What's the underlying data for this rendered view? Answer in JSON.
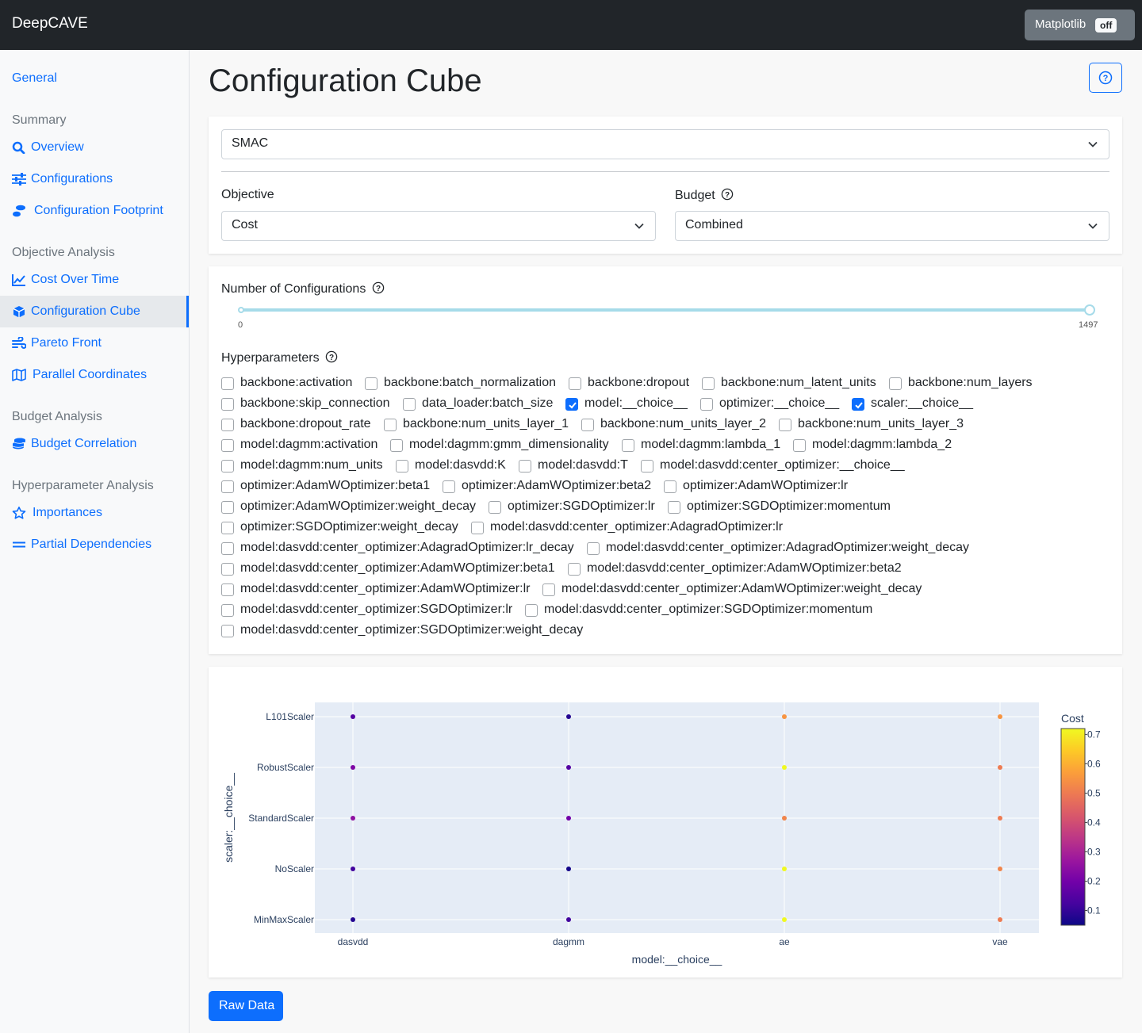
{
  "header": {
    "brand": "DeepCAVE",
    "matplotlib_label": "Matplotlib",
    "matplotlib_state": "off"
  },
  "sidebar": {
    "general": "General",
    "sections": [
      {
        "heading": "Summary",
        "items": [
          {
            "label": "Overview",
            "icon": "search-icon"
          },
          {
            "label": "Configurations",
            "icon": "sliders-icon"
          },
          {
            "label": "Configuration Footprint",
            "icon": "footprint-icon"
          }
        ]
      },
      {
        "heading": "Objective Analysis",
        "items": [
          {
            "label": "Cost Over Time",
            "icon": "line-chart-icon"
          },
          {
            "label": "Configuration Cube",
            "icon": "cube-icon",
            "active": true
          },
          {
            "label": "Pareto Front",
            "icon": "wind-icon"
          },
          {
            "label": "Parallel Coordinates",
            "icon": "map-icon"
          }
        ]
      },
      {
        "heading": "Budget Analysis",
        "items": [
          {
            "label": "Budget Correlation",
            "icon": "coins-icon"
          }
        ]
      },
      {
        "heading": "Hyperparameter Analysis",
        "items": [
          {
            "label": "Importances",
            "icon": "star-icon"
          },
          {
            "label": "Partial Dependencies",
            "icon": "equals-icon"
          }
        ]
      }
    ]
  },
  "main": {
    "title": "Configuration Cube",
    "run_select": "SMAC",
    "objective_label": "Objective",
    "objective_value": "Cost",
    "budget_label": "Budget",
    "budget_value": "Combined",
    "n_configs_label": "Number of Configurations",
    "slider": {
      "min": "0",
      "max": "1497",
      "value_fraction": 1.0
    },
    "hyperparameters_label": "Hyperparameters",
    "hyperparameters": [
      [
        {
          "label": "backbone:activation",
          "checked": false
        },
        {
          "label": "backbone:batch_normalization",
          "checked": false
        },
        {
          "label": "backbone:dropout",
          "checked": false
        },
        {
          "label": "backbone:num_latent_units",
          "checked": false
        },
        {
          "label": "backbone:num_layers",
          "checked": false
        }
      ],
      [
        {
          "label": "backbone:skip_connection",
          "checked": false
        },
        {
          "label": "data_loader:batch_size",
          "checked": false
        },
        {
          "label": "model:__choice__",
          "checked": true
        },
        {
          "label": "optimizer:__choice__",
          "checked": false
        },
        {
          "label": "scaler:__choice__",
          "checked": true
        }
      ],
      [
        {
          "label": "backbone:dropout_rate",
          "checked": false
        },
        {
          "label": "backbone:num_units_layer_1",
          "checked": false
        },
        {
          "label": "backbone:num_units_layer_2",
          "checked": false
        },
        {
          "label": "backbone:num_units_layer_3",
          "checked": false
        }
      ],
      [
        {
          "label": "model:dagmm:activation",
          "checked": false
        },
        {
          "label": "model:dagmm:gmm_dimensionality",
          "checked": false
        },
        {
          "label": "model:dagmm:lambda_1",
          "checked": false
        },
        {
          "label": "model:dagmm:lambda_2",
          "checked": false
        }
      ],
      [
        {
          "label": "model:dagmm:num_units",
          "checked": false
        },
        {
          "label": "model:dasvdd:K",
          "checked": false
        },
        {
          "label": "model:dasvdd:T",
          "checked": false
        },
        {
          "label": "model:dasvdd:center_optimizer:__choice__",
          "checked": false
        }
      ],
      [
        {
          "label": "optimizer:AdamWOptimizer:beta1",
          "checked": false
        },
        {
          "label": "optimizer:AdamWOptimizer:beta2",
          "checked": false
        },
        {
          "label": "optimizer:AdamWOptimizer:lr",
          "checked": false
        }
      ],
      [
        {
          "label": "optimizer:AdamWOptimizer:weight_decay",
          "checked": false
        },
        {
          "label": "optimizer:SGDOptimizer:lr",
          "checked": false
        },
        {
          "label": "optimizer:SGDOptimizer:momentum",
          "checked": false
        }
      ],
      [
        {
          "label": "optimizer:SGDOptimizer:weight_decay",
          "checked": false
        },
        {
          "label": "model:dasvdd:center_optimizer:AdagradOptimizer:lr",
          "checked": false
        }
      ],
      [
        {
          "label": "model:dasvdd:center_optimizer:AdagradOptimizer:lr_decay",
          "checked": false
        },
        {
          "label": "model:dasvdd:center_optimizer:AdagradOptimizer:weight_decay",
          "checked": false
        }
      ],
      [
        {
          "label": "model:dasvdd:center_optimizer:AdamWOptimizer:beta1",
          "checked": false
        },
        {
          "label": "model:dasvdd:center_optimizer:AdamWOptimizer:beta2",
          "checked": false
        }
      ],
      [
        {
          "label": "model:dasvdd:center_optimizer:AdamWOptimizer:lr",
          "checked": false
        },
        {
          "label": "model:dasvdd:center_optimizer:AdamWOptimizer:weight_decay",
          "checked": false
        }
      ],
      [
        {
          "label": "model:dasvdd:center_optimizer:SGDOptimizer:lr",
          "checked": false
        },
        {
          "label": "model:dasvdd:center_optimizer:SGDOptimizer:momentum",
          "checked": false
        }
      ],
      [
        {
          "label": "model:dasvdd:center_optimizer:SGDOptimizer:weight_decay",
          "checked": false
        }
      ]
    ],
    "raw_data_button": "Raw Data"
  },
  "chart_data": {
    "type": "scatter",
    "x_categories": [
      "dasvdd",
      "dagmm",
      "ae",
      "vae"
    ],
    "y_categories": [
      "MinMaxScaler",
      "NoScaler",
      "StandardScaler",
      "RobustScaler",
      "L101Scaler"
    ],
    "xlabel": "model:__choice__",
    "ylabel": "scaler:__choice__",
    "colorbar_title": "Cost",
    "colorbar_ticks": [
      "0.1",
      "0.2",
      "0.3",
      "0.4",
      "0.5",
      "0.6",
      "0.7"
    ],
    "colorscale": "plasma",
    "crange": [
      0.05,
      0.72
    ],
    "points": [
      {
        "x": "dasvdd",
        "y": "L101Scaler",
        "cost": 0.15
      },
      {
        "x": "dagmm",
        "y": "L101Scaler",
        "cost": 0.08
      },
      {
        "x": "ae",
        "y": "L101Scaler",
        "cost": 0.55
      },
      {
        "x": "vae",
        "y": "L101Scaler",
        "cost": 0.55
      },
      {
        "x": "dasvdd",
        "y": "RobustScaler",
        "cost": 0.22
      },
      {
        "x": "dagmm",
        "y": "RobustScaler",
        "cost": 0.15
      },
      {
        "x": "ae",
        "y": "RobustScaler",
        "cost": 0.72
      },
      {
        "x": "vae",
        "y": "RobustScaler",
        "cost": 0.5
      },
      {
        "x": "dasvdd",
        "y": "StandardScaler",
        "cost": 0.25
      },
      {
        "x": "dagmm",
        "y": "StandardScaler",
        "cost": 0.2
      },
      {
        "x": "ae",
        "y": "StandardScaler",
        "cost": 0.52
      },
      {
        "x": "vae",
        "y": "StandardScaler",
        "cost": 0.5
      },
      {
        "x": "dasvdd",
        "y": "NoScaler",
        "cost": 0.12
      },
      {
        "x": "dagmm",
        "y": "NoScaler",
        "cost": 0.06
      },
      {
        "x": "ae",
        "y": "NoScaler",
        "cost": 0.72
      },
      {
        "x": "vae",
        "y": "NoScaler",
        "cost": 0.52
      },
      {
        "x": "dasvdd",
        "y": "MinMaxScaler",
        "cost": 0.08
      },
      {
        "x": "dagmm",
        "y": "MinMaxScaler",
        "cost": 0.12
      },
      {
        "x": "ae",
        "y": "MinMaxScaler",
        "cost": 0.72
      },
      {
        "x": "vae",
        "y": "MinMaxScaler",
        "cost": 0.5
      }
    ]
  },
  "colors": {
    "primary": "#0d6efd",
    "navbar": "#212529",
    "plot_bg": "#e5ecf6"
  }
}
